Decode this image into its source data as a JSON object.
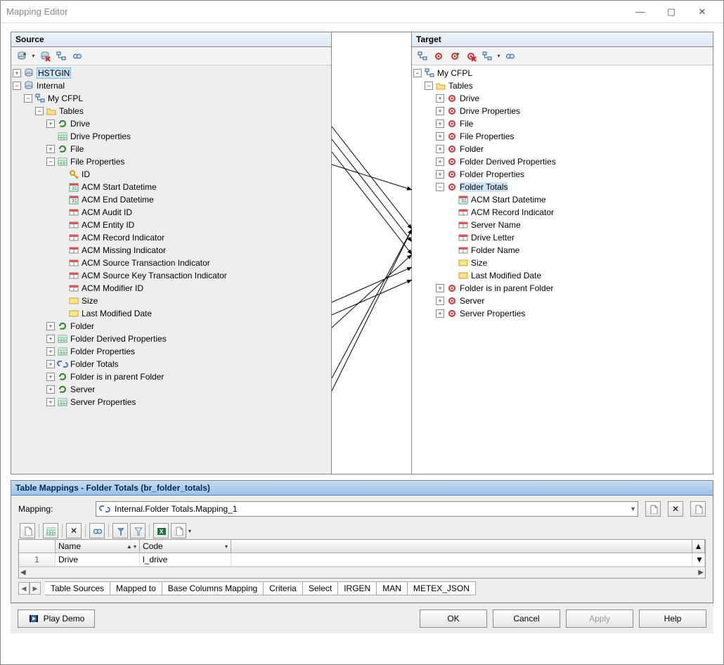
{
  "window": {
    "title": "Mapping Editor"
  },
  "source": {
    "header": "Source",
    "tree": {
      "hstgin": "HSTGIN",
      "internal": "Internal",
      "mycfpl": "My CFPL",
      "tables": "Tables",
      "drive": "Drive",
      "drive_props": "Drive Properties",
      "file": "File",
      "file_props": "File Properties",
      "fp_id": "ID",
      "fp_acm_start": "ACM Start Datetime",
      "fp_acm_end": "ACM End Datetime",
      "fp_acm_audit": "ACM Audit ID",
      "fp_acm_entity": "ACM Entity ID",
      "fp_acm_record": "ACM Record Indicator",
      "fp_acm_missing": "ACM Missing Indicator",
      "fp_acm_src_tx": "ACM Source Transaction Indicator",
      "fp_acm_src_key": "ACM Source Key Transaction Indicator",
      "fp_acm_modifier": "ACM Modifier ID",
      "fp_size": "Size",
      "fp_lastmod": "Last Modified Date",
      "folder": "Folder",
      "folder_derived": "Folder Derived Properties",
      "folder_props": "Folder Properties",
      "folder_totals": "Folder Totals",
      "folder_parent": "Folder is in parent Folder",
      "server": "Server",
      "server_props": "Server Properties"
    }
  },
  "target": {
    "header": "Target",
    "tree": {
      "mycfpl": "My CFPL",
      "tables": "Tables",
      "drive": "Drive",
      "drive_props": "Drive Properties",
      "file": "File",
      "file_props": "File Properties",
      "folder": "Folder",
      "folder_derived": "Folder Derived Properties",
      "folder_props": "Folder Properties",
      "folder_totals": "Folder Totals",
      "ft_acm_start": "ACM Start Datetime",
      "ft_acm_record": "ACM Record Indicator",
      "ft_server_name": "Server Name",
      "ft_drive_letter": "Drive Letter",
      "ft_folder_name": "Folder Name",
      "ft_size": "Size",
      "ft_lastmod": "Last Modified Date",
      "folder_parent": "Folder is in parent Folder",
      "server": "Server",
      "server_props": "Server Properties"
    }
  },
  "table_mappings": {
    "header": "Table Mappings - Folder Totals (br_folder_totals)",
    "label": "Mapping:",
    "value": "Internal.Folder Totals.Mapping_1",
    "columns": {
      "name": "Name",
      "code": "Code"
    },
    "row": {
      "num": "1",
      "name": "Drive",
      "code": "l_drive"
    },
    "tabs": {
      "t1": "Table Sources",
      "t2": "Mapped to",
      "t3": "Base Columns Mapping",
      "t4": "Criteria",
      "t5": "Select",
      "t6": "IRGEN",
      "t7": "MAN",
      "t8": "METEX_JSON"
    }
  },
  "buttons": {
    "play_demo": "Play Demo",
    "ok": "OK",
    "cancel": "Cancel",
    "apply": "Apply",
    "help": "Help"
  }
}
